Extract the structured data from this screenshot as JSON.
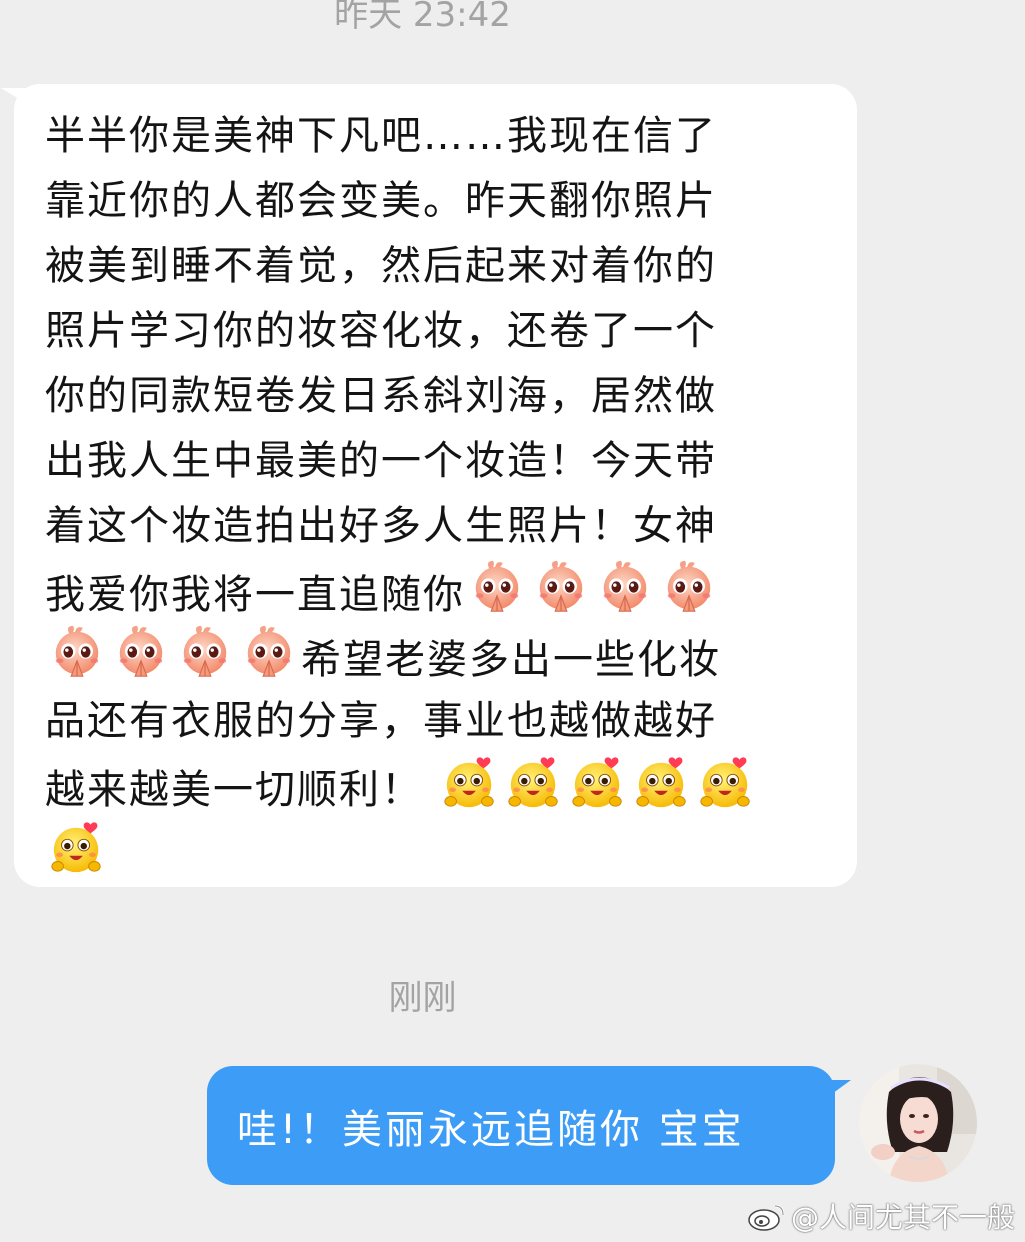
{
  "timestamps": {
    "first": "昨天 23:42",
    "second": "刚刚"
  },
  "incoming_message": {
    "lines": [
      "半半你是美神下凡吧……我现在信了",
      "靠近你的人都会变美。昨天翻你照片",
      "被美到睡不着觉，然后起来对着你的",
      "照片学习你的妆容化妆，还卷了一个",
      "你的同款短卷发日系斜刘海，居然做",
      "出我人生中最美的一个妆造！今天带",
      "着这个妆造拍出好多人生照片！女神",
      "我爱你我将一直追随你",
      "希望老婆多出一些化妆",
      "品还有衣服的分享，事业也越做越好",
      "越来越美一切顺利！"
    ],
    "emoji_pray_name": "pray-emoji",
    "emoji_love_name": "love-emoji"
  },
  "outgoing_message": {
    "text": "哇!！美丽永远追随你 宝宝"
  },
  "watermark": {
    "text": "@人间尤其不一般",
    "icon": "weibo-logo-icon"
  },
  "colors": {
    "background": "#eeeeee",
    "incoming_bubble": "#ffffff",
    "outgoing_bubble": "#3d9df6",
    "timestamp": "#a3a3a3"
  }
}
